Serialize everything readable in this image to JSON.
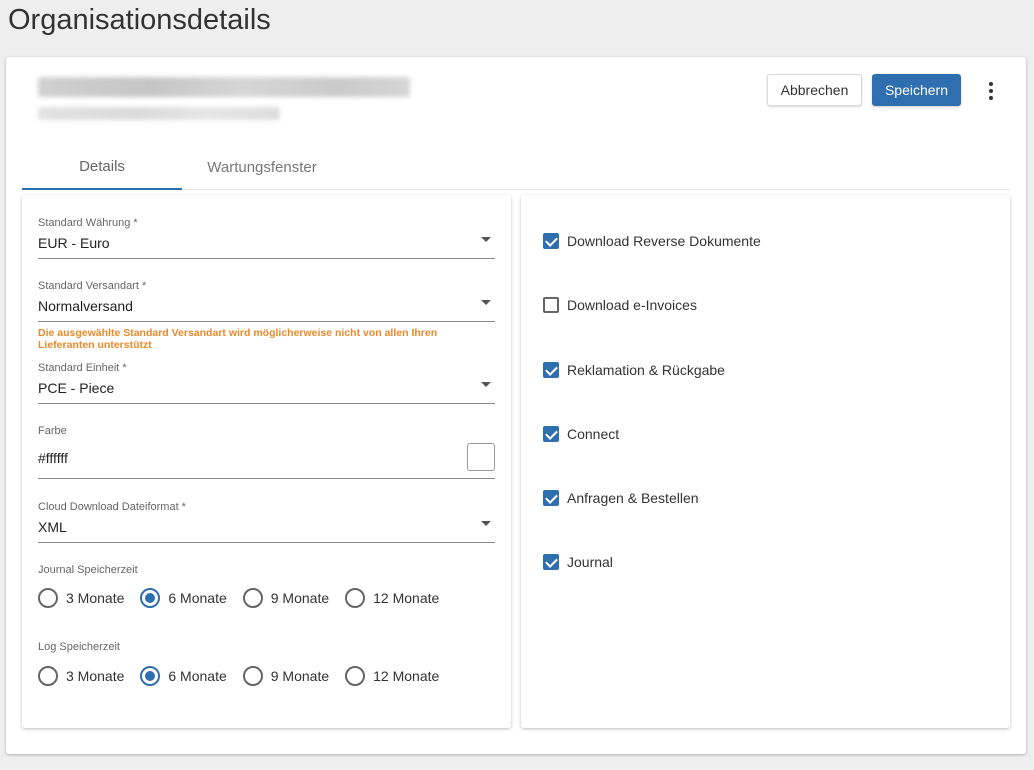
{
  "page": {
    "title": "Organisationsdetails"
  },
  "header": {
    "cancel_label": "Abbrechen",
    "save_label": "Speichern"
  },
  "tabs": [
    {
      "label": "Details",
      "active": true
    },
    {
      "label": "Wartungsfenster",
      "active": false
    }
  ],
  "form": {
    "currency": {
      "label": "Standard Währung *",
      "value": "EUR - Euro"
    },
    "shipping": {
      "label": "Standard Versandart *",
      "value": "Normalversand",
      "warning": "Die ausgewählte Standard Versandart wird möglicherweise nicht von allen Ihren Lieferanten unterstützt"
    },
    "unit": {
      "label": "Standard Einheit *",
      "value": "PCE - Piece"
    },
    "color": {
      "label": "Farbe",
      "value": "#ffffff",
      "swatch": "#ffffff"
    },
    "file_format": {
      "label": "Cloud Download Dateiformat *",
      "value": "XML"
    },
    "journal_retention": {
      "label": "Journal Speicherzeit",
      "options": [
        "3 Monate",
        "6 Monate",
        "9 Monate",
        "12 Monate"
      ],
      "selected": "6 Monate"
    },
    "log_retention": {
      "label": "Log Speicherzeit",
      "options": [
        "3 Monate",
        "6 Monate",
        "9 Monate",
        "12 Monate"
      ],
      "selected": "6 Monate"
    }
  },
  "features": [
    {
      "label": "Download Reverse Dokumente",
      "checked": true
    },
    {
      "label": "Download e-Invoices",
      "checked": false
    },
    {
      "label": "Reklamation & Rückgabe",
      "checked": true
    },
    {
      "label": "Connect",
      "checked": true
    },
    {
      "label": "Anfragen & Bestellen",
      "checked": true
    },
    {
      "label": "Journal",
      "checked": true
    }
  ],
  "colors": {
    "accent": "#2f6fb0",
    "warning": "#e8892b",
    "background": "#efefef"
  }
}
